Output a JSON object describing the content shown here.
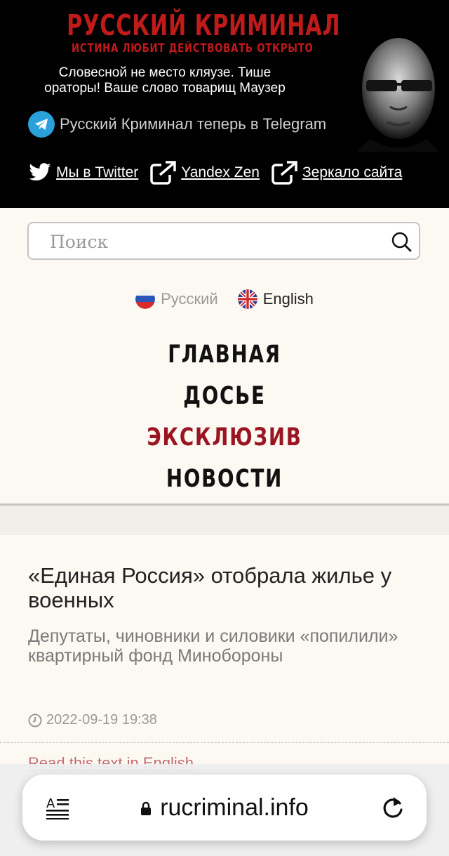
{
  "header": {
    "logo_title": "РУССКИЙ КРИМИНАЛ",
    "logo_subtitle": "ИСТИНА ЛЮБИТ ДЕЙСТВОВАТЬ ОТКРЫТО",
    "quote": "Словесной не место кляузе. Тише ораторы! Ваше слово товарищ Маузер",
    "telegram_text": "Русский Криминал теперь в Telegram",
    "social_links": [
      {
        "label": "Мы в Twitter",
        "icon": "twitter-icon"
      },
      {
        "label": "Yandex Zen",
        "icon": "external-link-icon"
      },
      {
        "label": "Зеркало сайта",
        "icon": "external-link-icon"
      }
    ]
  },
  "search": {
    "placeholder": "Поиск"
  },
  "languages": [
    {
      "label": "Русский",
      "active": false
    },
    {
      "label": "English",
      "active": true
    }
  ],
  "menu": [
    {
      "label": "ГЛАВНАЯ"
    },
    {
      "label": "ДОСЬЕ"
    },
    {
      "label": "ЭКСКЛЮЗИВ"
    },
    {
      "label": "НОВОСТИ"
    }
  ],
  "article": {
    "title": "«Единая Россия» отобрала жилье у военных",
    "lead": "Депутаты, чиновники и силовики «попилили» квартирный фонд Минобороны",
    "date": "2022-09-19 19:38",
    "read_english": "Read this text in English"
  },
  "browser": {
    "url": "rucriminal.info"
  },
  "colors": {
    "header_bg": "#000000",
    "logo_red": "#c01a1a",
    "menu_active": "#9a1522",
    "page_bg": "#fcf9f3",
    "telegram_blue": "#2aa1da"
  }
}
